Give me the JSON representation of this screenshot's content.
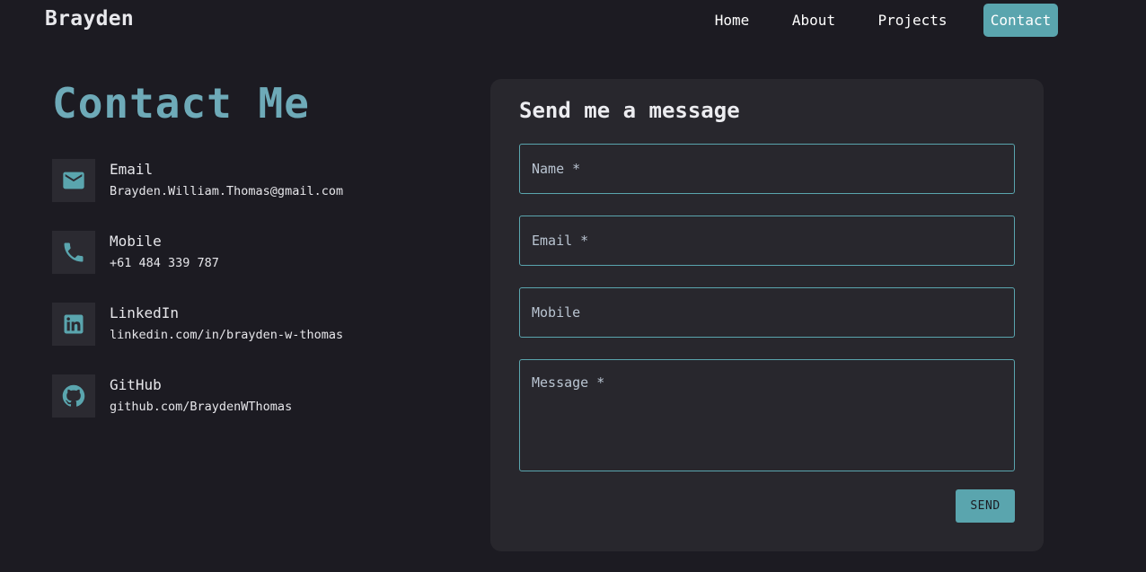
{
  "header": {
    "brand": "Brayden",
    "nav": [
      "Home",
      "About",
      "Projects",
      "Contact"
    ],
    "active": "Contact"
  },
  "contact": {
    "title": "Contact Me",
    "items": [
      {
        "icon": "email-icon",
        "label": "Email",
        "value": "Brayden.William.Thomas@gmail.com"
      },
      {
        "icon": "phone-icon",
        "label": "Mobile",
        "value": "+61 484 339 787"
      },
      {
        "icon": "linkedin-icon",
        "label": "LinkedIn",
        "value": "linkedin.com/in/brayden-w-thomas"
      },
      {
        "icon": "github-icon",
        "label": "GitHub",
        "value": "github.com/BraydenWThomas"
      }
    ]
  },
  "form": {
    "title": "Send me a message",
    "name_placeholder": "Name *",
    "email_placeholder": "Email *",
    "mobile_placeholder": "Mobile",
    "message_placeholder": "Message *",
    "send_label": "SEND"
  },
  "colors": {
    "accent": "#5aa5ae",
    "title": "#6eaab8",
    "background": "#1c1b22",
    "card": "#28272d"
  }
}
